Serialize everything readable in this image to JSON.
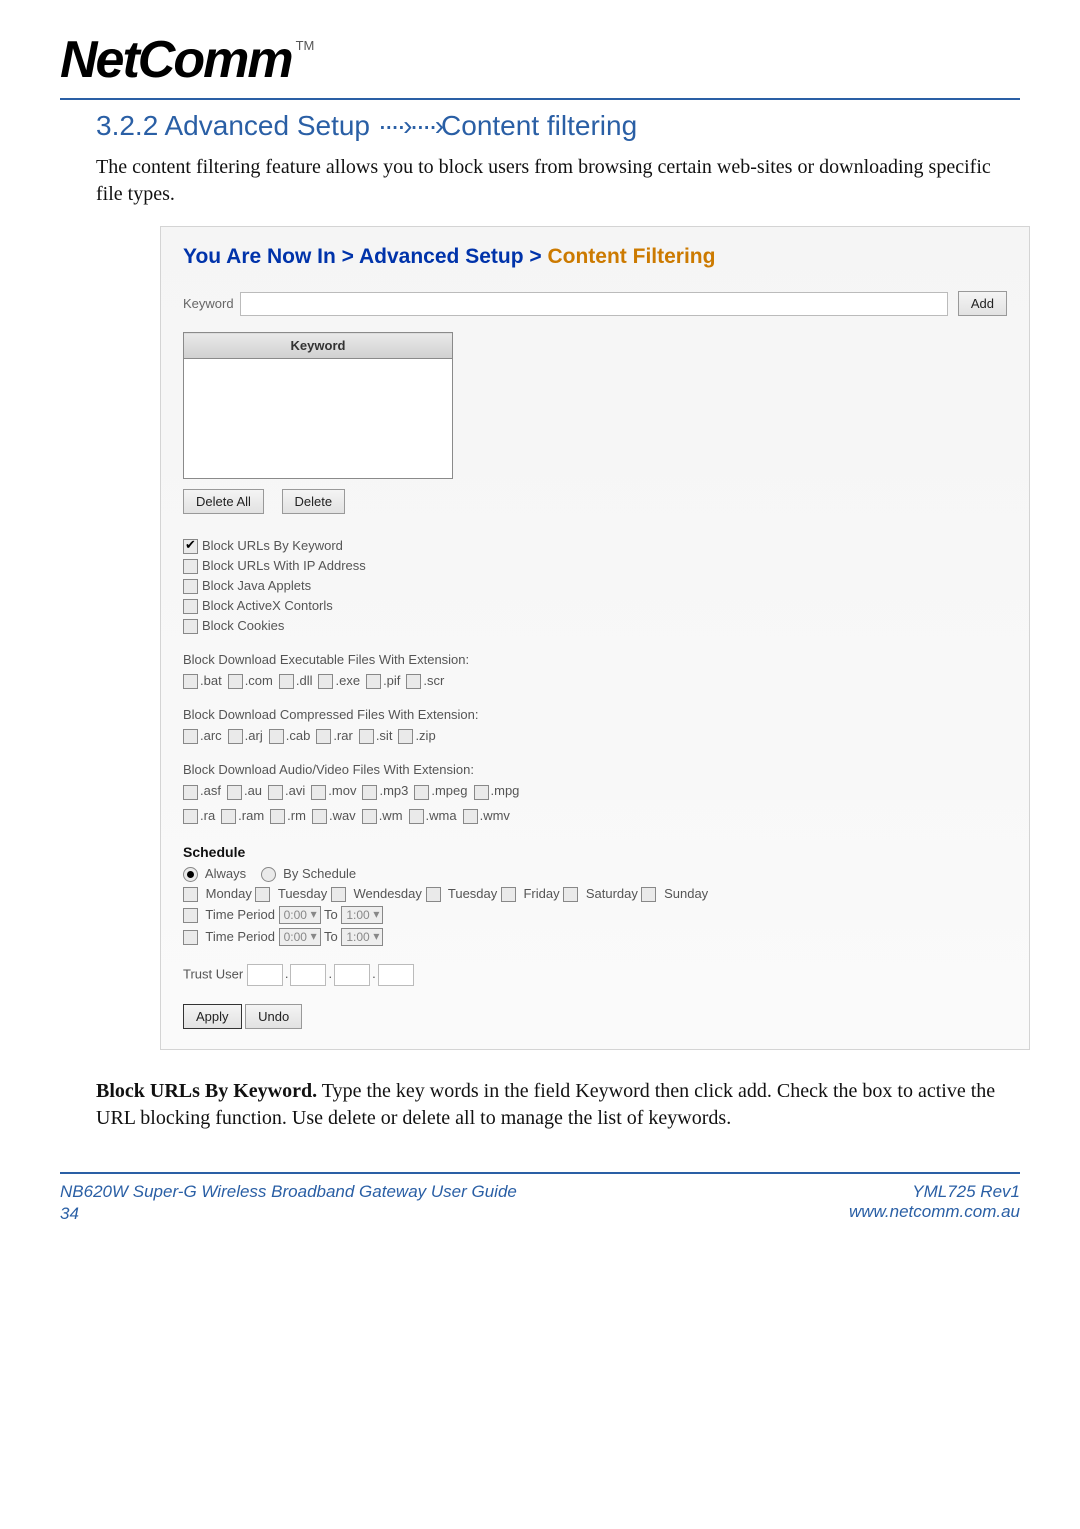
{
  "logo": {
    "brand": "NetComm",
    "tm": "TM"
  },
  "section_title_parts": {
    "num": "3.2.2 Advanced Setup ",
    "arrow": "····›····›",
    "rest": "Content filtering"
  },
  "intro": "The content filtering feature allows you to block users from browsing certain web-sites or downloading  specific file types.",
  "crumb": {
    "p1": "You Are Now In",
    "gt1": " > ",
    "p2": "Advanced Setup",
    "gt2": " > ",
    "p3": "Content Filtering"
  },
  "keyword": {
    "label": "Keyword",
    "add_btn": "Add",
    "table_header": "Keyword",
    "delete_all_btn": "Delete All",
    "delete_btn": "Delete"
  },
  "block_opts": [
    {
      "label": "Block URLs By Keyword",
      "checked": true
    },
    {
      "label": "Block URLs With IP Address",
      "checked": false
    },
    {
      "label": "Block Java Applets",
      "checked": false
    },
    {
      "label": "Block ActiveX Contorls",
      "checked": false
    },
    {
      "label": "Block Cookies",
      "checked": false
    }
  ],
  "exec_title": "Block Download Executable Files With Extension:",
  "exec_ext": [
    ".bat",
    ".com",
    ".dll",
    ".exe",
    ".pif",
    ".scr"
  ],
  "comp_title": "Block Download Compressed Files With Extension:",
  "comp_ext": [
    ".arc",
    ".arj",
    ".cab",
    ".rar",
    ".sit",
    ".zip"
  ],
  "av_title": "Block Download Audio/Video Files With Extension:",
  "av_row1": [
    ".asf",
    ".au",
    ".avi",
    ".mov",
    ".mp3",
    ".mpeg",
    ".mpg"
  ],
  "av_row2": [
    ".ra",
    ".ram",
    ".rm",
    ".wav",
    ".wm",
    ".wma",
    ".wmv"
  ],
  "schedule": {
    "title": "Schedule",
    "always": "Always",
    "by_schedule": "By Schedule",
    "days": [
      "Monday",
      "Tuesday",
      "Wendesday",
      "Tuesday",
      "Friday",
      "Saturday",
      "Sunday"
    ],
    "time_period": "Time Period",
    "t_from": "0:00",
    "to": "To",
    "t_to": "1:00"
  },
  "trust_user": "Trust User",
  "apply_btn": "Apply",
  "undo_btn": "Undo",
  "body_after_parts": {
    "b": "Block URLs By Keyword.",
    "rest": " Type the key words in the field Keyword then click add. Check the box to active the URL blocking function.  Use delete or delete all to manage the list of keywords."
  },
  "footer": {
    "left": "NB620W Super-G Wireless Broadband  Gateway User Guide",
    "page": "34",
    "right_top": "YML725 Rev1",
    "right_bottom": "www.netcomm.com.au"
  }
}
